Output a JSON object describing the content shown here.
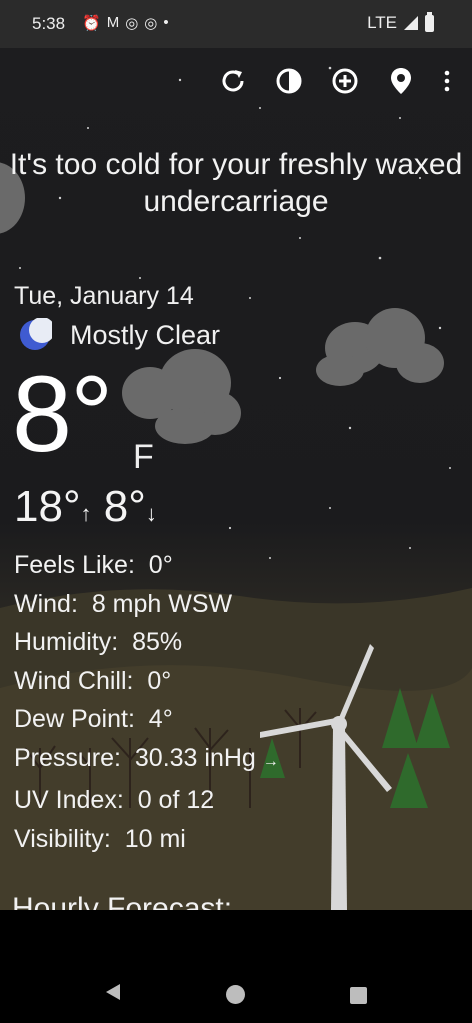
{
  "status": {
    "time": "5:38",
    "icons": [
      "alarm-icon",
      "gmail-icon",
      "instagram-icon",
      "instagram-icon",
      "dot-icon"
    ],
    "network": "LTE"
  },
  "toolbar": {
    "icons": [
      "refresh-icon",
      "theme-icon",
      "add-location-icon",
      "location-pin-icon",
      "more-options-icon"
    ]
  },
  "weather": {
    "tagline": "It's too cold for your freshly waxed undercarriage",
    "date": "Tue, January 14",
    "condition": "Mostly Clear",
    "temperature": "8°",
    "unit": "F",
    "high": "18°",
    "low": "8°",
    "details": [
      {
        "label": "Feels Like:",
        "value": "0°"
      },
      {
        "label": "Wind:",
        "value": "8 mph WSW"
      },
      {
        "label": "Humidity:",
        "value": "85%"
      },
      {
        "label": "Wind Chill:",
        "value": "0°"
      },
      {
        "label": "Dew Point:",
        "value": "4°"
      },
      {
        "label": "Pressure:",
        "value": "30.33 inHg"
      },
      {
        "label": "UV Index:",
        "value": "0 of 12"
      },
      {
        "label": "Visibility:",
        "value": "10 mi"
      }
    ],
    "hourly_title": "Hourly Forecast:"
  },
  "colors": {
    "moon": "#3f5bd1",
    "sky": "#1d1d1f",
    "ground": "#403a2a"
  }
}
